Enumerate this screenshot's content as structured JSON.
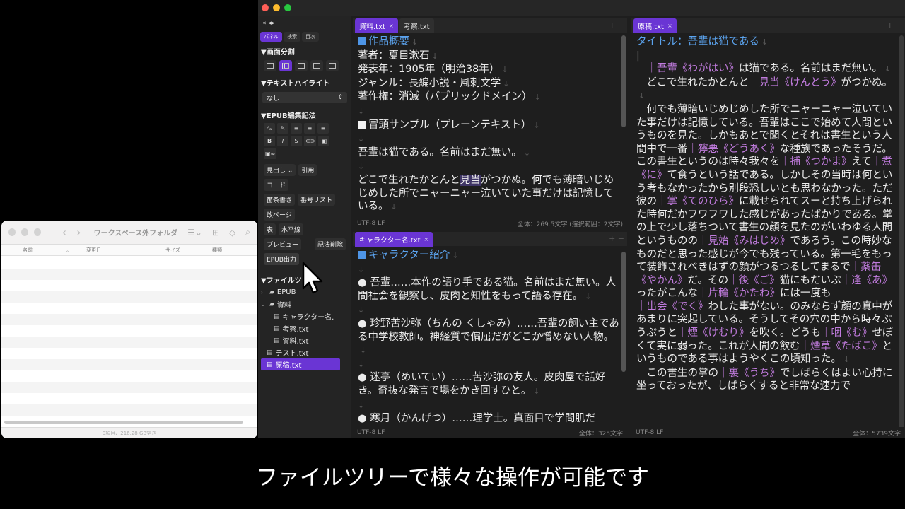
{
  "finder": {
    "title": "ワークスペース外フォルダ",
    "columns": [
      "名前",
      "変更日",
      "サイズ",
      "種類"
    ],
    "status": "0項目、216.28 GB空き"
  },
  "sidebar": {
    "top_icons": "«  ◂▸",
    "tabs": [
      "パネル",
      "検索",
      "目次"
    ],
    "sec_layout": "▼画面分割",
    "sec_highlight": "▼テキストハイライト",
    "highlight_value": "なし",
    "sec_epub": "▼EPUB編集記法",
    "fmt_row1": [
      "ᴬₐ",
      "✎",
      "≡",
      "≡",
      "≡"
    ],
    "fmt_row2": [
      "B",
      "I",
      "S",
      "⊂⊃",
      "▣"
    ],
    "fmt_row3": [
      "▣∞"
    ],
    "chips1": [
      "見出し ⌄",
      "引用"
    ],
    "chips2": [
      "コード"
    ],
    "chips3": [
      "箇条書き",
      "番号リスト"
    ],
    "chips4": [
      "改ページ"
    ],
    "chips5": [
      "表",
      "水平線"
    ],
    "chips6": [
      "プレビュー",
      "記法削除"
    ],
    "chips7": [
      "EPUB出力"
    ],
    "sec_files": "▼ファイルツ",
    "tree": [
      {
        "name": "EPUB",
        "twist": "›",
        "icon": "▰",
        "indent": 0
      },
      {
        "name": "資料",
        "twist": "⌄",
        "icon": "▰",
        "indent": 0
      },
      {
        "name": "キャラクター名.",
        "twist": "",
        "icon": "▤",
        "indent": 2
      },
      {
        "name": "考察.txt",
        "twist": "",
        "icon": "▤",
        "indent": 2
      },
      {
        "name": "資料.txt",
        "twist": "",
        "icon": "▤",
        "indent": 2
      },
      {
        "name": "テスト.txt",
        "twist": "",
        "icon": "▤",
        "indent": 1
      },
      {
        "name": "原稿.txt",
        "twist": "",
        "icon": "▤",
        "indent": 1
      }
    ]
  },
  "pane1": {
    "tabs": [
      {
        "label": "資料.txt",
        "close": "×"
      },
      {
        "label": "考察.txt",
        "close": ""
      }
    ],
    "ctrl": "+  −",
    "heading": "作品概要",
    "lines": [
      "著者：夏目漱石",
      "発表年：1905年（明治38年）",
      "ジャンル：長編小説・風刺文学",
      "著作権：消滅（パブリックドメイン）"
    ],
    "heading2": "冒頭サンプル（プレーンテキスト）",
    "sample1": "吾輩は猫である。名前はまだ無い。",
    "sample2a": "どこで生れたかとんと",
    "sample2hl": "見当",
    "sample2b": "がつかぬ。何でも薄暗いじめじめした所でニャーニャー泣いていた事だけは記憶している。",
    "status_left": "UTF-8   LF",
    "status_right": "全体：269.5文字 (選択範囲：2文字)"
  },
  "pane2": {
    "tabs": [
      {
        "label": "キャラクター名.txt",
        "close": "×"
      }
    ],
    "ctrl": "+  −",
    "heading": "キャラクター紹介",
    "items": [
      "● 吾輩……本作の語り手である猫。名前はまだ無い。人間社会を観察し、皮肉と知性をもって語る存在。",
      "● 珍野苦沙弥（ちんの くしゃみ）……吾輩の飼い主である中学校教師。神経質で偏屈だがどこか憎めない人物。",
      "● 迷亭（めいてい）……苦沙弥の友人。皮肉屋で話好き。奇抜な発言で場をかき回すひと。",
      "● 寒月（かんげつ）……理学士。真面目で学問肌だ"
    ],
    "status_left": "UTF-8   LF",
    "status_right": "全体：325文字"
  },
  "pane3": {
    "tabs": [
      {
        "label": "原稿.txt",
        "close": "×"
      }
    ],
    "ctrl": "+  −",
    "title": "タイトル：吾輩は猫である",
    "status_left": "UTF-8   LF",
    "status_right": "全体：5739文字"
  },
  "caption": "ファイルツリーで様々な操作が可能です",
  "colors": {
    "accent": "#6a35d4",
    "heading": "#5ba3ee",
    "ruby": "#c07bdd"
  }
}
